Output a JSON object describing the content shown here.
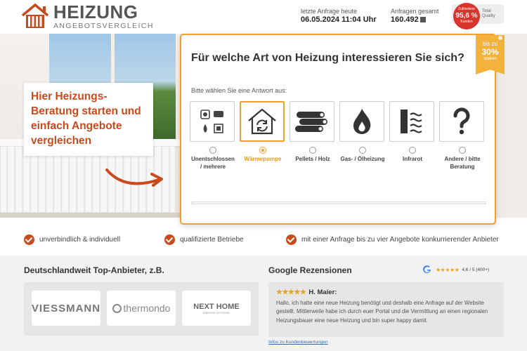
{
  "header": {
    "logo_title": "HEIZUNG",
    "logo_subtitle": "ANGEBOTSVERGLEICH",
    "last_request_label": "letzte Anfrage heute",
    "last_request_value": "06.05.2024 11:04 Uhr",
    "total_requests_label": "Anfragen gesamt",
    "total_requests_value": "160.492",
    "seal_top": "Zufriedene",
    "seal_percent": "95,6 %",
    "seal_bottom": "Kunden",
    "quality_label": "Total Quality"
  },
  "hero": {
    "headline": "Hier Heizungs-Beratung starten und einfach Angebote vergleichen"
  },
  "form": {
    "question": "Für welche Art von Heizung interessieren Sie sich?",
    "instruction": "Bitte wählen Sie eine Antwort aus:",
    "badge": {
      "top": "bis zu",
      "value": "30%",
      "bottom": "sparen"
    },
    "selected_index": 1,
    "options": [
      {
        "label": "Unentschlossen / mehrere",
        "icon": "multiple-heating-icon"
      },
      {
        "label": "Wärmepumpe",
        "icon": "heat-pump-icon"
      },
      {
        "label": "Pellets / Holz",
        "icon": "wood-logs-icon"
      },
      {
        "label": "Gas- / Ölheizung",
        "icon": "flame-icon"
      },
      {
        "label": "Infrarot",
        "icon": "infrared-icon"
      },
      {
        "label": "Andere / bitte Beratung",
        "icon": "question-mark-icon"
      }
    ]
  },
  "benefits": [
    "unverbindlich & individuell",
    "qualifizierte Betriebe",
    "mit einer Anfrage bis zu vier Angebote konkurrierender Anbieter"
  ],
  "providers": {
    "title": "Deutschlandweit Top-Anbieter, z.B.",
    "logos": [
      "VIESSMANN",
      "thermondo",
      "NEXT HOME",
      "ENERGIE SYSTEME"
    ]
  },
  "reviews": {
    "title": "Google Rezensionen",
    "rating_text": "4,6 / 5 (400+)",
    "review_author": "H. Maier:",
    "review_text": "Hallo, ich hatte eine neue Heizung benötigt und deshalb eine Anfrage auf der Website gestellt. Mittlerweile habe ich durch euer Portal und die Vermittlung an einen regionalen Heizungsbauer eine neue Heizung und bin super happy damit.",
    "link_text": "Infos zu Kundenbewertungen"
  },
  "colors": {
    "accent_orange": "#f0a030",
    "brand_red": "#c94a1c",
    "star_gold": "#e8a317"
  }
}
